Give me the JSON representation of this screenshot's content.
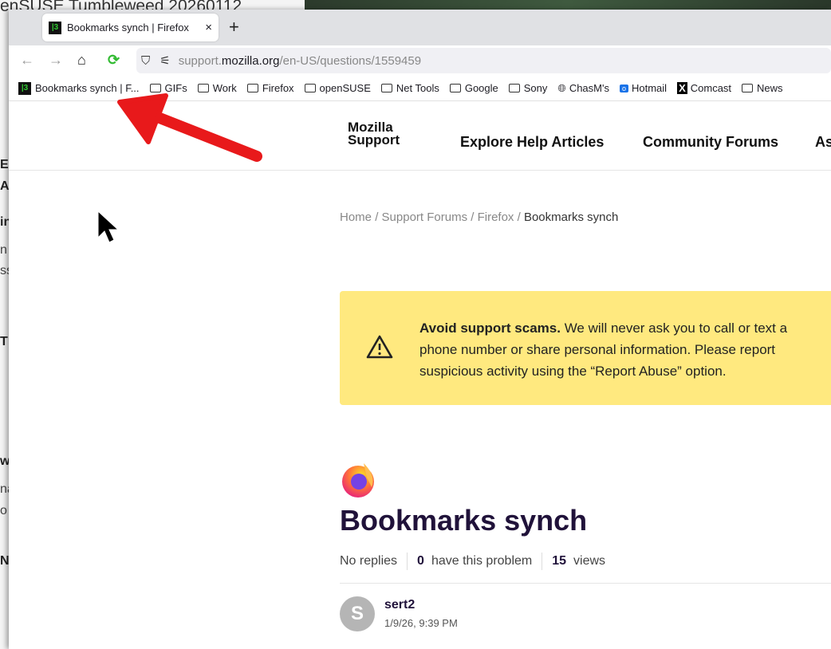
{
  "background_window": {
    "title": "enSUSE Tumbleweed 20260112",
    "fragments": [
      "E",
      "A",
      "in",
      "n",
      "ss",
      "T",
      "w",
      "na",
      "o",
      "N"
    ]
  },
  "tab": {
    "title": "Bookmarks synch | Firefox",
    "close": "×",
    "new_tab": "+"
  },
  "url": {
    "prefix": "support.",
    "domain": "mozilla.org",
    "path": "/en-US/questions/1559459"
  },
  "bookmarks": [
    {
      "label": "Bookmarks synch | F...",
      "icon": "site-favicon"
    },
    {
      "label": "GIFs",
      "icon": "folder"
    },
    {
      "label": "Work",
      "icon": "folder"
    },
    {
      "label": "Firefox",
      "icon": "folder"
    },
    {
      "label": "openSUSE",
      "icon": "folder"
    },
    {
      "label": "Net Tools",
      "icon": "folder"
    },
    {
      "label": "Google",
      "icon": "folder"
    },
    {
      "label": "Sony",
      "icon": "folder"
    },
    {
      "label": "ChasM's",
      "icon": "globe"
    },
    {
      "label": "Hotmail",
      "icon": "outlook"
    },
    {
      "label": "Comcast",
      "icon": "x-logo"
    },
    {
      "label": "News",
      "icon": "folder"
    }
  ],
  "header": {
    "logo_line1": "Mozilla",
    "logo_line2": "Support",
    "nav": [
      "Explore Help Articles",
      "Community Forums",
      "As"
    ]
  },
  "breadcrumb": {
    "home": "Home",
    "forums": "Support Forums",
    "product": "Firefox",
    "current": "Bookmarks synch",
    "sep": "/"
  },
  "alert": {
    "bold": "Avoid support scams.",
    "text": " We will never ask you to call or text a phone number or share personal information. Please report suspicious activity using the “Report Abuse” option."
  },
  "question": {
    "title": "Bookmarks synch",
    "replies": "No replies",
    "problem_count": "0",
    "problem_label": "have this problem",
    "views_count": "15",
    "views_label": "views"
  },
  "post": {
    "avatar_letter": "S",
    "user": "sert2",
    "date": "1/9/26, 9:39 PM"
  },
  "colors": {
    "alert_bg": "#ffe97f",
    "title": "#20123a",
    "arrow": "#e8191b"
  }
}
